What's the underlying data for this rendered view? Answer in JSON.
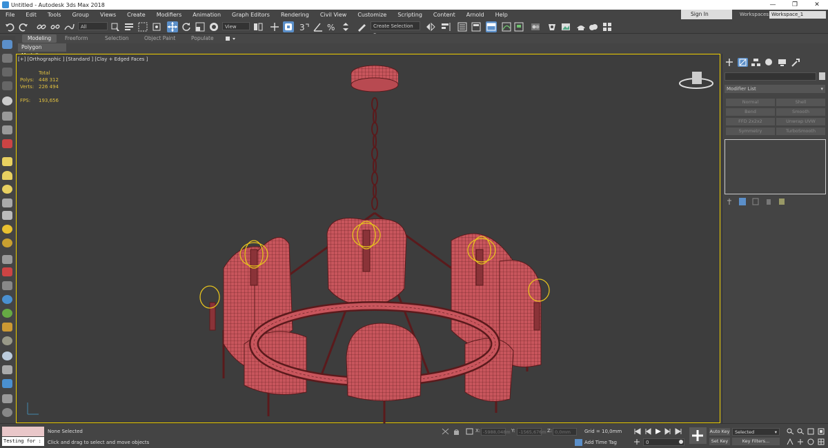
{
  "window": {
    "title": "Untitled - Autodesk 3ds Max 2018",
    "minimize": "—",
    "maximize": "❐",
    "close": "✕"
  },
  "menu": [
    "File",
    "Edit",
    "Tools",
    "Group",
    "Views",
    "Create",
    "Modifiers",
    "Animation",
    "Graph Editors",
    "Rendering",
    "Civil View",
    "Customize",
    "Scripting",
    "Content",
    "Arnold",
    "Help"
  ],
  "account": {
    "sign_in": "Sign In",
    "workspaces_label": "Workspaces:",
    "workspace": "Workspace_1"
  },
  "toolbar": {
    "selection_filter": "All",
    "reference_coord": "View",
    "named_selection": "Create Selection Se"
  },
  "ribbon": {
    "tabs": [
      "Modeling",
      "Freeform",
      "Selection",
      "Object Paint",
      "Populate"
    ],
    "active_tab": "Modeling",
    "panel": "Polygon Modeling"
  },
  "viewport": {
    "label": "[+] [Orthographic ] [Standard ] [Clay + Edged Faces ]",
    "stats": {
      "header": "Total",
      "polys_label": "Polys:",
      "polys": "448 312",
      "verts_label": "Verts:",
      "verts": "226 494",
      "fps_label": "FPS:",
      "fps": "193,656"
    }
  },
  "command_panel": {
    "modifier_list": "Modifier List",
    "modifier_buttons": [
      "Normal",
      "Shell",
      "Bend",
      "Smooth",
      "FFD 2x2x2",
      "Unwrap UVW",
      "Symmetry",
      "TurboSmooth"
    ]
  },
  "status": {
    "maxscript": "Testing for :",
    "selection": "None Selected",
    "prompt": "Click and drag to select and move objects",
    "x_label": "X:",
    "x": "-5988,048m",
    "y_label": "Y:",
    "y": "-1565,676m",
    "z_label": "Z:",
    "z": "0,0mm",
    "grid": "Grid = 10,0mm",
    "add_time_tag": "Add Time Tag",
    "frame": "0",
    "auto_key": "Auto Key",
    "set_key": "Set Key",
    "key_mode": "Selected",
    "key_filters": "Key Filters..."
  },
  "colors": {
    "mesh": "#c8555c",
    "wire": "#5a1a1c",
    "selection_bracket": "#e6c21e",
    "active_tool": "#5b8fc9"
  }
}
